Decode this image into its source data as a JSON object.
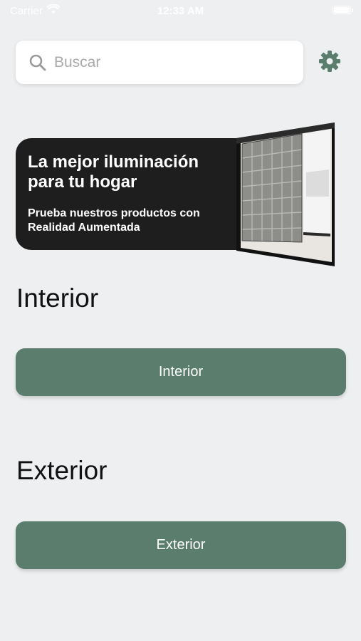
{
  "status_bar": {
    "carrier": "Carrier",
    "time": "12:33 AM"
  },
  "search": {
    "placeholder": "Buscar",
    "value": ""
  },
  "icons": {
    "search": "search-icon",
    "settings": "gear-icon",
    "wifi": "wifi-icon",
    "battery": "battery-icon"
  },
  "banner": {
    "title": "La mejor iluminación para tu hogar",
    "subtitle": "Prueba nuestros productos con Realidad Aumentada"
  },
  "sections": {
    "interior": {
      "heading": "Interior",
      "button_label": "Interior"
    },
    "exterior": {
      "heading": "Exterior",
      "button_label": "Exterior"
    }
  },
  "colors": {
    "background": "#edeff1",
    "accent": "#5a7d6d",
    "banner_bg": "#1e1e1e"
  }
}
